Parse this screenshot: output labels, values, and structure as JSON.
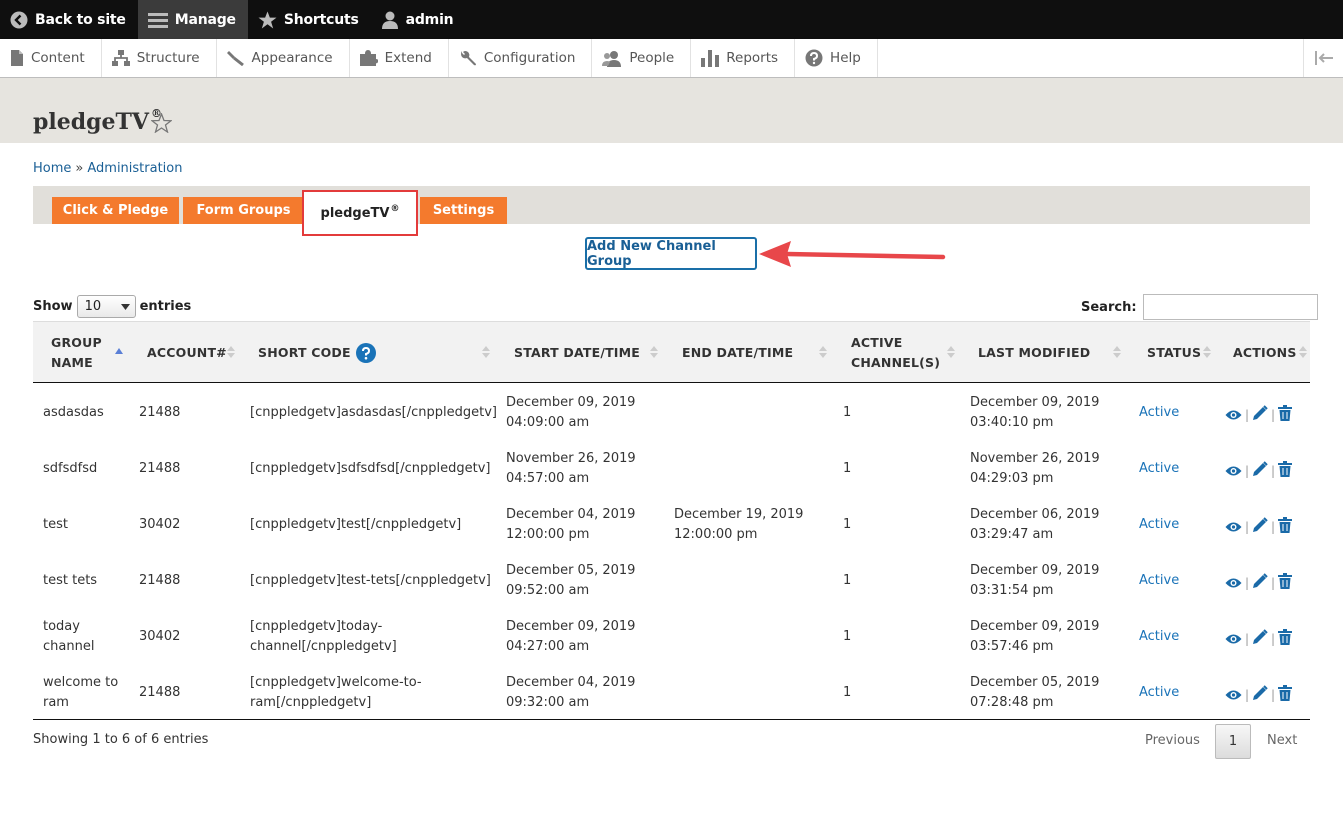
{
  "toolbar": {
    "back": "Back to site",
    "manage": "Manage",
    "shortcuts": "Shortcuts",
    "user": "admin"
  },
  "tray": [
    "Content",
    "Structure",
    "Appearance",
    "Extend",
    "Configuration",
    "People",
    "Reports",
    "Help"
  ],
  "page": {
    "title": "pledgeTV",
    "title_mark": "®"
  },
  "breadcrumb": {
    "home": "Home",
    "sep": "»",
    "admin": "Administration"
  },
  "tabs": {
    "click_pledge": "Click & Pledge",
    "form_groups": "Form Groups",
    "pledgetv": "pledgeTV",
    "pledgetv_mark": "®",
    "settings": "Settings"
  },
  "add_button": "Add New Channel Group",
  "length": {
    "show": "Show",
    "value": "10",
    "entries": "entries"
  },
  "search": {
    "label": "Search:",
    "value": ""
  },
  "table": {
    "headers": {
      "group_name_1": "GROUP",
      "group_name_2": "NAME",
      "account": "ACCOUNT#",
      "short_code": "SHORT CODE",
      "start": "START DATE/TIME",
      "end": "END DATE/TIME",
      "active_1": "ACTIVE",
      "active_2": "CHANNEL(S)",
      "modified": "LAST MODIFIED",
      "status": "STATUS",
      "actions": "ACTIONS"
    },
    "rows": [
      {
        "name1": "asdasdas",
        "name2": "",
        "account": "21488",
        "code1": "[cnppledgetv]asdasdas[/cnppledgetv]",
        "code2": "",
        "start1": "December 09, 2019",
        "start2": "04:09:00 am",
        "end1": "",
        "end2": "",
        "active": "1",
        "mod1": "December 09, 2019",
        "mod2": "03:40:10 pm",
        "status": "Active"
      },
      {
        "name1": "sdfsdfsd",
        "name2": "",
        "account": "21488",
        "code1": "[cnppledgetv]sdfsdfsd[/cnppledgetv]",
        "code2": "",
        "start1": "November 26, 2019",
        "start2": "04:57:00 am",
        "end1": "",
        "end2": "",
        "active": "1",
        "mod1": "November 26, 2019",
        "mod2": "04:29:03 pm",
        "status": "Active"
      },
      {
        "name1": "test",
        "name2": "",
        "account": "30402",
        "code1": "[cnppledgetv]test[/cnppledgetv]",
        "code2": "",
        "start1": "December 04, 2019",
        "start2": "12:00:00 pm",
        "end1": "December 19, 2019",
        "end2": "12:00:00 pm",
        "active": "1",
        "mod1": "December 06, 2019",
        "mod2": "03:29:47 am",
        "status": "Active"
      },
      {
        "name1": "test tets",
        "name2": "",
        "account": "21488",
        "code1": "[cnppledgetv]test-tets[/cnppledgetv]",
        "code2": "",
        "start1": "December 05, 2019",
        "start2": "09:52:00 am",
        "end1": "",
        "end2": "",
        "active": "1",
        "mod1": "December 09, 2019",
        "mod2": "03:31:54 pm",
        "status": "Active"
      },
      {
        "name1": "today",
        "name2": "channel",
        "account": "30402",
        "code1": "[cnppledgetv]today-",
        "code2": "channel[/cnppledgetv]",
        "start1": "December 09, 2019",
        "start2": "04:27:00 am",
        "end1": "",
        "end2": "",
        "active": "1",
        "mod1": "December 09, 2019",
        "mod2": "03:57:46 pm",
        "status": "Active"
      },
      {
        "name1": "welcome to",
        "name2": "ram",
        "account": "21488",
        "code1": "[cnppledgetv]welcome-to-",
        "code2": "ram[/cnppledgetv]",
        "start1": "December 04, 2019",
        "start2": "09:32:00 am",
        "end1": "",
        "end2": "",
        "active": "1",
        "mod1": "December 05, 2019",
        "mod2": "07:28:48 pm",
        "status": "Active"
      }
    ]
  },
  "footer": {
    "info": "Showing 1 to 6 of 6 entries",
    "previous": "Previous",
    "page": "1",
    "next": "Next"
  },
  "colors": {
    "tab_orange": "#f47a2d",
    "link_blue": "#1a5f95",
    "highlight_red": "#e33b3b"
  }
}
